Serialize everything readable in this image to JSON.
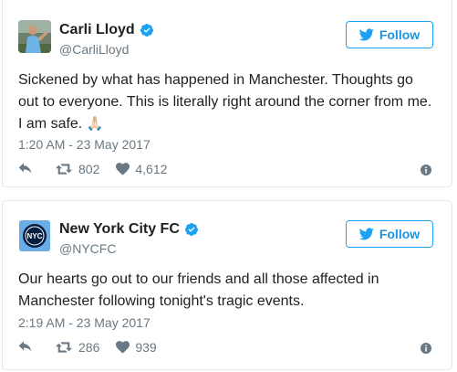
{
  "tweets": [
    {
      "display_name": "Carli Lloyd",
      "handle": "@CarliLloyd",
      "follow_label": "Follow",
      "text_line_1": "Sickened by what has happened in Manchester. Thoughts go",
      "text_line_2": "out to everyone. This is literally right around the corner from me.",
      "text_line_3": "I am safe.",
      "emoji": "🙏🏻",
      "timestamp": "1:20 AM - 23 May 2017",
      "retweets": "802",
      "likes": "4,612",
      "avatar_icon": "soccer-player-photo"
    },
    {
      "display_name": "New York City FC",
      "handle": "@NYCFC",
      "follow_label": "Follow",
      "text_line_1": "Our hearts go out to our friends and all those affected in",
      "text_line_2": "Manchester following tonight's tragic events.",
      "timestamp": "2:19 AM - 23 May 2017",
      "retweets": "286",
      "likes": "939",
      "avatar_icon": "nycfc-crest"
    }
  ],
  "colors": {
    "accent": "#1da1f2",
    "follow_text": "#1b95e0",
    "muted": "#697882",
    "text": "#1c2022",
    "border": "#e1e8ed"
  },
  "icons": {
    "reply": "reply-icon",
    "retweet": "retweet-icon",
    "like": "heart-icon",
    "info": "info-icon",
    "verified": "verified-badge-icon",
    "bird": "twitter-bird-icon"
  }
}
